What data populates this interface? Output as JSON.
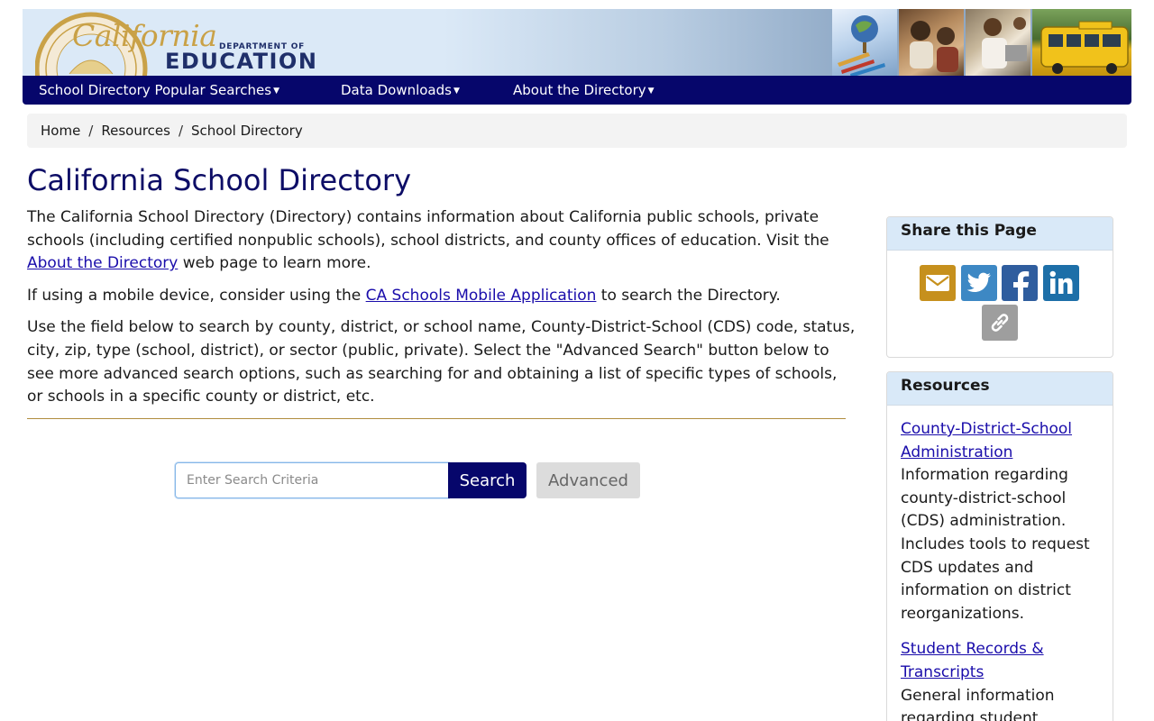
{
  "banner": {
    "logo_word": "California",
    "logo_dept": "DEPARTMENT OF",
    "logo_edu": "EDUCATION"
  },
  "nav": {
    "items": [
      {
        "label": "School Directory Popular Searches"
      },
      {
        "label": "Data Downloads"
      },
      {
        "label": "About the Directory"
      }
    ]
  },
  "breadcrumb": {
    "items": [
      "Home",
      "Resources",
      "School Directory"
    ],
    "separator": "/"
  },
  "main": {
    "title": "California School Directory",
    "p1_before": "The California School Directory (Directory) contains information about California public schools, private schools (including certified nonpublic schools), school districts, and county offices of education. Visit the ",
    "p1_link": "About the Directory",
    "p1_after": " web page to learn more.",
    "p2_before": "If using a mobile device, consider using the ",
    "p2_link": "CA Schools Mobile Application",
    "p2_after": " to search the Directory.",
    "p3": "Use the field below to search by county, district, or school name, County-District-School (CDS) code, status, city, zip, type (school, district), or sector (public, private). Select the \"Advanced Search\" button below to see more advanced search options, such as searching for and obtaining a list of specific types of schools, or schools in a specific county or district, etc."
  },
  "search": {
    "placeholder": "Enter Search Criteria",
    "value": "",
    "search_label": "Search",
    "advanced_label": "Advanced"
  },
  "sidebar": {
    "share_title": "Share this Page",
    "share_icons": [
      "email-icon",
      "twitter-icon",
      "facebook-icon",
      "linkedin-icon",
      "link-icon"
    ],
    "resources_title": "Resources",
    "resources": [
      {
        "link": "County-District-School Administration",
        "description": "Information regarding county-district-school (CDS) administration. Includes tools to request CDS updates and information on district reorganizations."
      },
      {
        "link": "Student Records & Transcripts",
        "description": "General information regarding student"
      }
    ]
  },
  "colors": {
    "nav_bg": "#06066b",
    "title": "#0d0d66",
    "link": "#1a0dab",
    "accent_gold": "#c9a147",
    "card_header": "#d9e9f8"
  }
}
